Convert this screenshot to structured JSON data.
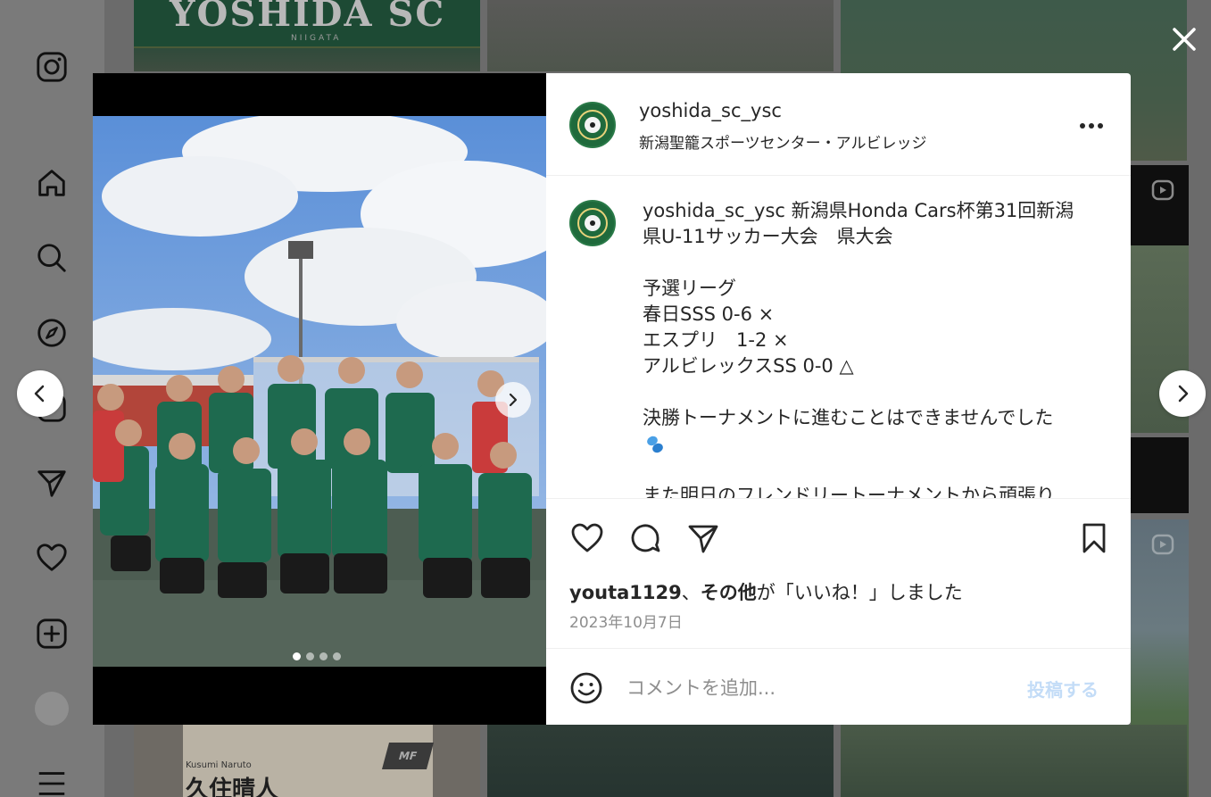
{
  "sidebar": {
    "icons": [
      "instagram-logo-icon",
      "home-icon",
      "search-icon",
      "explore-icon",
      "reels-icon",
      "messages-icon",
      "notifications-heart-icon",
      "create-icon",
      "profile-avatar",
      "more-menu-icon"
    ]
  },
  "background_grid": {
    "banner_text": "YOSHIDA SC",
    "banner_subtext": "NIIGATA",
    "promo_name": "Kusumi Naruto",
    "promo_title": "久住晴人",
    "promo_badge": "MF"
  },
  "post": {
    "author": "yoshida_sc_ysc",
    "location": "新潟聖籠スポーツセンター・アルビレッジ",
    "caption": {
      "author": "yoshida_sc_ysc",
      "first_line": " 新潟県Honda Cars杯第31回新潟",
      "second_line": "県U-11サッカー大会　県大会",
      "lines": [
        "予選リーグ",
        "春日SSS 0-6 ×",
        "エスプリ　1-2 ×",
        "アルビレックスSS 0-0 △",
        "",
        "決勝トーナメントに進むことはできませんでした",
        "",
        "また明日のフレンドリートーナメントから頑張り"
      ]
    },
    "likes": {
      "user": "youta1129",
      "separator": "、",
      "others": "その他",
      "suffix": "が「いいね！」しました"
    },
    "date": "2023年10月7日",
    "media": {
      "slide_count": 4,
      "active_slide": 1
    }
  },
  "comment": {
    "placeholder": "コメントを追加...",
    "post_label": "投稿する"
  },
  "colors": {
    "text": "#262626",
    "muted": "#8e8e8e",
    "post_disabled": "#c3dcf7",
    "overlay": "#6b6b6b"
  }
}
